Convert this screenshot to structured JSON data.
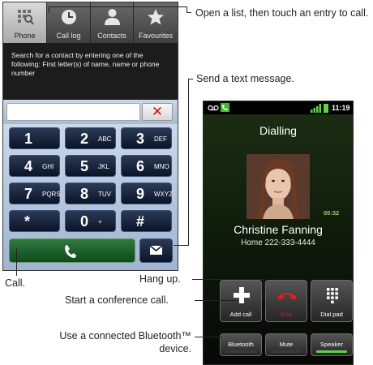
{
  "colors": {
    "accent_red": "#d11a1a",
    "accent_green": "#5fd24a"
  },
  "dialer": {
    "tabs": [
      {
        "label": "Phone",
        "icon": "dialpad-search-icon"
      },
      {
        "label": "Call log",
        "icon": "clock-icon"
      },
      {
        "label": "Contacts",
        "icon": "person-icon"
      },
      {
        "label": "Favourites",
        "icon": "star-icon"
      }
    ],
    "hint": "Search for a contact by entering one of the following: First letter(s) of name, name or phone number",
    "search": {
      "value": "",
      "placeholder": ""
    },
    "keys": [
      {
        "digit": "1",
        "letters": ""
      },
      {
        "digit": "2",
        "letters": "ABC"
      },
      {
        "digit": "3",
        "letters": "DEF"
      },
      {
        "digit": "4",
        "letters": "GHI"
      },
      {
        "digit": "5",
        "letters": "JKL"
      },
      {
        "digit": "6",
        "letters": "MNO"
      },
      {
        "digit": "7",
        "letters": "PQRS"
      },
      {
        "digit": "8",
        "letters": "TUV"
      },
      {
        "digit": "9",
        "letters": "WXYZ"
      },
      {
        "digit": "*",
        "letters": ""
      },
      {
        "digit": "0",
        "letters": "+"
      },
      {
        "digit": "#",
        "letters": ""
      }
    ]
  },
  "incall": {
    "status_time": "11:19",
    "state": "Dialling",
    "timer": "05:32",
    "caller_name": "Christine Fanning",
    "caller_number": "Home 222-333-4444",
    "buttons": [
      {
        "label": "Add call",
        "icon": "plus-icon"
      },
      {
        "label": "End",
        "icon": "end-call-icon"
      },
      {
        "label": "Dial pad",
        "icon": "dialpad-icon"
      }
    ],
    "toggles": [
      {
        "label": "Bluetooth"
      },
      {
        "label": "Mute"
      },
      {
        "label": "Speaker"
      }
    ]
  },
  "callouts": {
    "open_list": "Open a list, then touch an entry to call.",
    "send_text": "Send a text message.",
    "call": "Call.",
    "hang_up": "Hang up.",
    "conference": "Start a conference call.",
    "bluetooth_line1": "Use a connected Bluetooth™",
    "bluetooth_line2": "device."
  }
}
